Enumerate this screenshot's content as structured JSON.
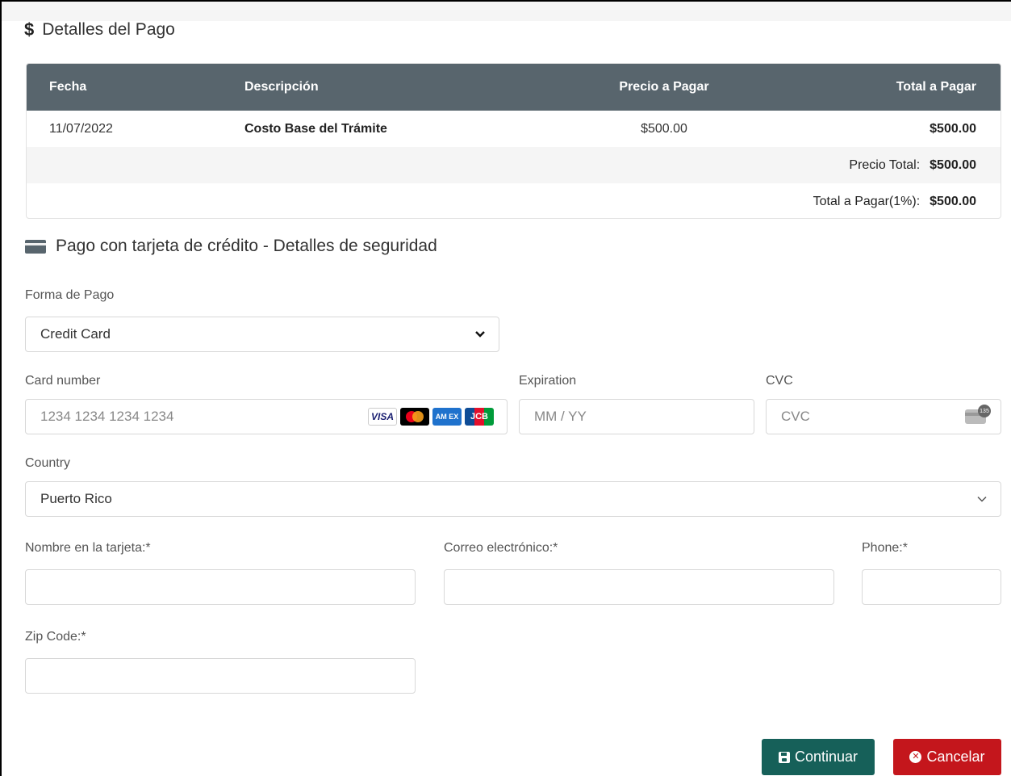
{
  "payment_details": {
    "title": "Detalles del Pago",
    "dollar_symbol": "$",
    "columns": {
      "fecha": "Fecha",
      "descripcion": "Descripción",
      "precio": "Precio a Pagar",
      "total": "Total a Pagar"
    },
    "rows": [
      {
        "fecha": "11/07/2022",
        "descripcion": "Costo Base del Trámite",
        "precio": "$500.00",
        "total": "$500.00"
      }
    ],
    "precio_total_label": "Precio Total:",
    "precio_total_value": "$500.00",
    "total_pagar_label": "Total a Pagar(1%):",
    "total_pagar_value": "$500.00"
  },
  "card_section": {
    "title": "Pago con tarjeta de crédito - Detalles de seguridad"
  },
  "form": {
    "forma_pago_label": "Forma de Pago",
    "forma_pago_value": "Credit Card",
    "card_number_label": "Card number",
    "card_number_placeholder": "1234 1234 1234 1234",
    "card_brands": [
      "visa-icon",
      "mastercard-icon",
      "amex-icon",
      "jcb-icon"
    ],
    "visa_text": "VISA",
    "amex_text": "AM EX",
    "jcb_text": "JCB",
    "expiration_label": "Expiration",
    "expiration_placeholder": "MM / YY",
    "cvc_label": "CVC",
    "cvc_placeholder": "CVC",
    "cvc_badge": "135",
    "country_label": "Country",
    "country_value": "Puerto Rico",
    "nombre_label": "Nombre en la tarjeta:*",
    "correo_label": "Correo electrónico:*",
    "phone_label": "Phone:*",
    "zip_label": "Zip Code:*"
  },
  "buttons": {
    "continuar": "Continuar",
    "cancelar": "Cancelar"
  },
  "colors": {
    "table_header": "#58656d",
    "continue_button": "#166059",
    "cancel_button": "#c4161c"
  }
}
